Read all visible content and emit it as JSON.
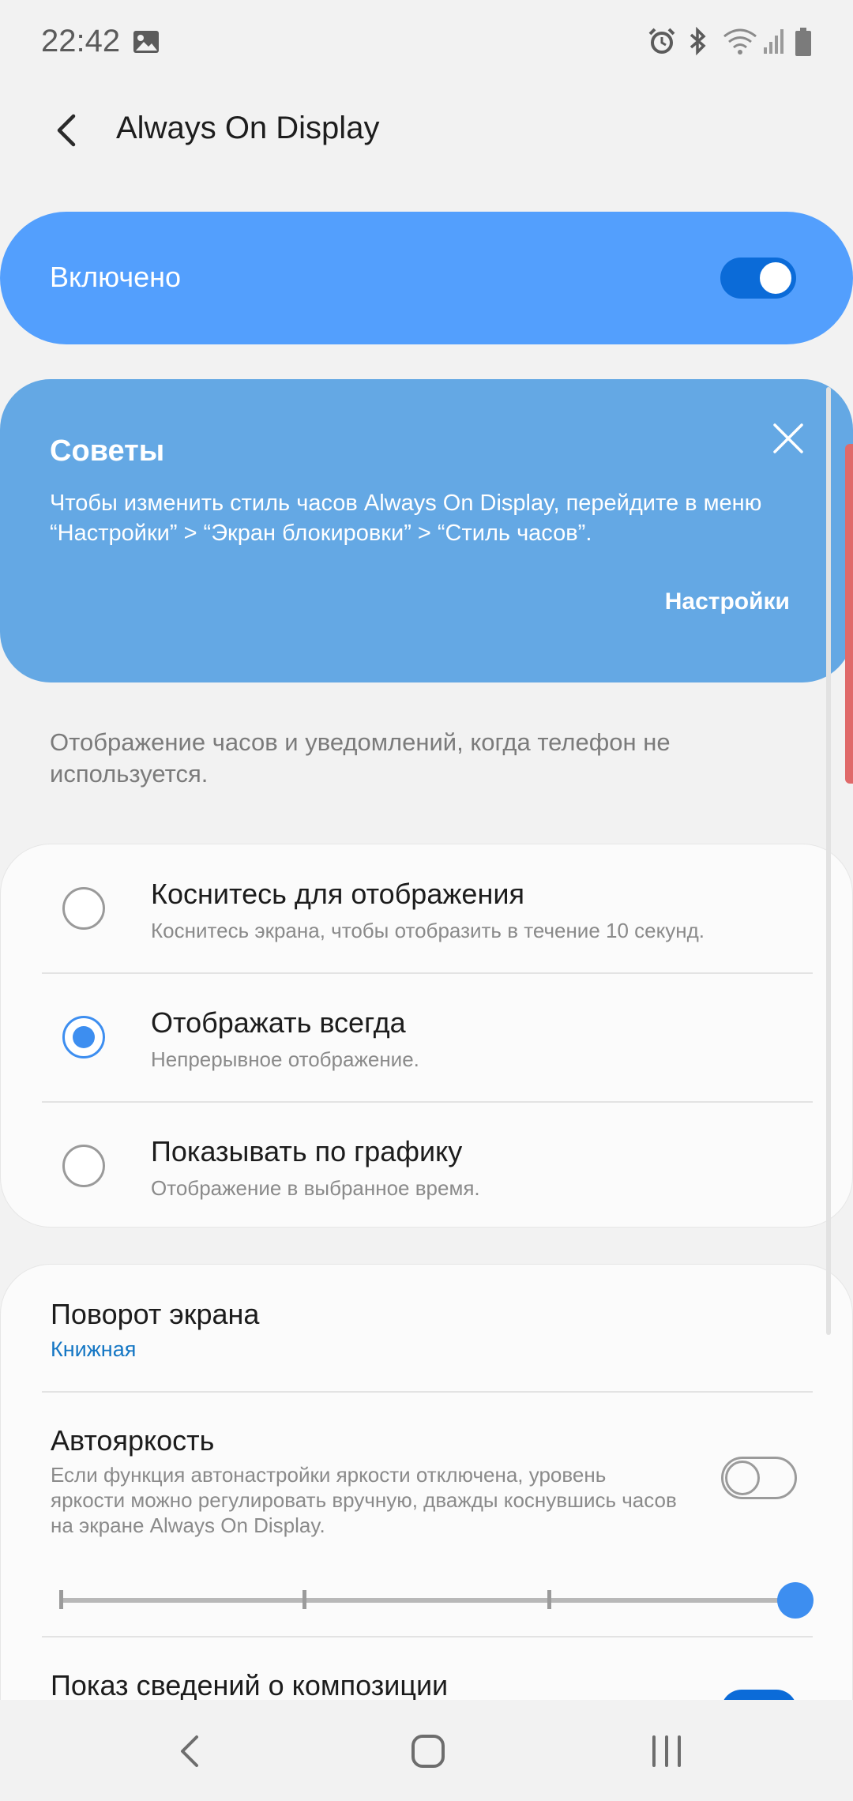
{
  "status_bar": {
    "time": "22:42",
    "icons": [
      "image-icon",
      "alarm-icon",
      "bluetooth-icon",
      "wifi-icon",
      "signal-icon",
      "battery-icon"
    ]
  },
  "header": {
    "title": "Always On Display"
  },
  "master_switch": {
    "label": "Включено",
    "on": true
  },
  "tips": {
    "title": "Советы",
    "body": "Чтобы изменить стиль часов Always On Display, перейдите в меню “Настройки” > “Экран блокировки” > “Стиль часов”.",
    "action": "Настройки"
  },
  "description": "Отображение часов и уведомлений, когда телефон не используется.",
  "modes": [
    {
      "title": "Коснитесь для отображения",
      "subtitle": "Коснитесь экрана, чтобы отобразить в течение 10 секунд.",
      "selected": false
    },
    {
      "title": "Отображать всегда",
      "subtitle": "Непрерывное отображение.",
      "selected": true
    },
    {
      "title": "Показывать по графику",
      "subtitle": "Отображение в выбранное время.",
      "selected": false
    }
  ],
  "settings": {
    "rotation_title": "Поворот экрана",
    "rotation_value": "Книжная",
    "auto_brightness_title": "Автояркость",
    "auto_brightness_desc": "Если функция автонастройки яркости отключена, уровень яркости можно регулировать вручную, дважды коснувшись часов на экране Always On Display.",
    "auto_brightness_on": false,
    "brightness_level": 1.0,
    "composition_title": "Показ сведений о композиции",
    "composition_on": true
  },
  "colors": {
    "accent": "#3d8ef0",
    "master_card": "#539ffd",
    "tips_card": "#64a8e4",
    "toggle_on": "#0b6bd8",
    "link": "#1577c4"
  },
  "nav": [
    "back-nav-icon",
    "home-nav-icon",
    "recents-nav-icon"
  ]
}
